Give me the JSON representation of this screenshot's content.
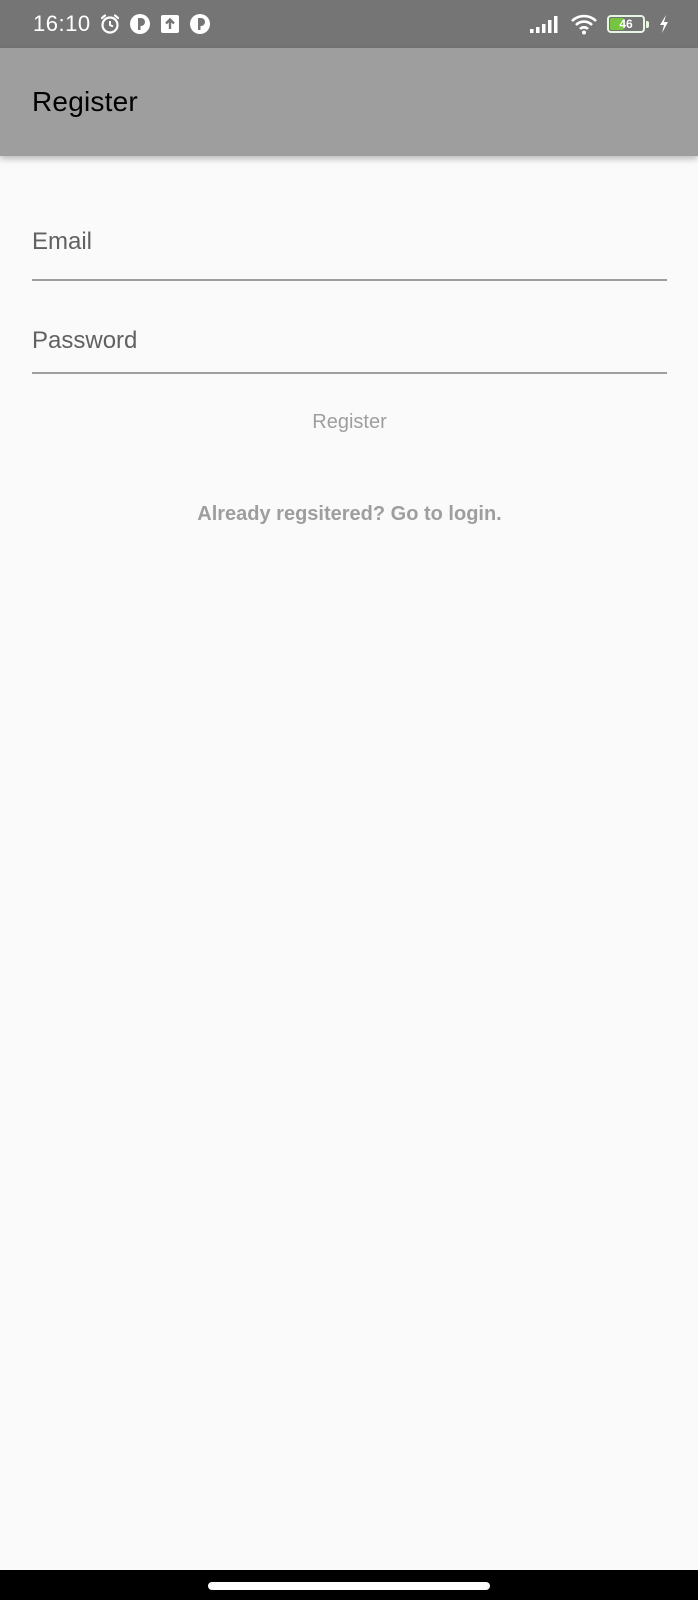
{
  "status_bar": {
    "time": "16:10",
    "left_icons": [
      "alarm-icon",
      "app-notification-icon",
      "upload-icon",
      "app-notification-icon"
    ],
    "right_icons": [
      "signal-icon",
      "wifi-icon",
      "battery-icon",
      "charging-icon"
    ],
    "battery_level": "46",
    "battery_fraction": 0.46,
    "battery_color": "#76c442"
  },
  "app_bar": {
    "title": "Register",
    "color": "#9e9e9e"
  },
  "form": {
    "email_placeholder": "Email",
    "email_value": "",
    "password_placeholder": "Password",
    "password_value": "",
    "register_label": "Register",
    "login_link_label": "Already regsitered? Go to login."
  }
}
